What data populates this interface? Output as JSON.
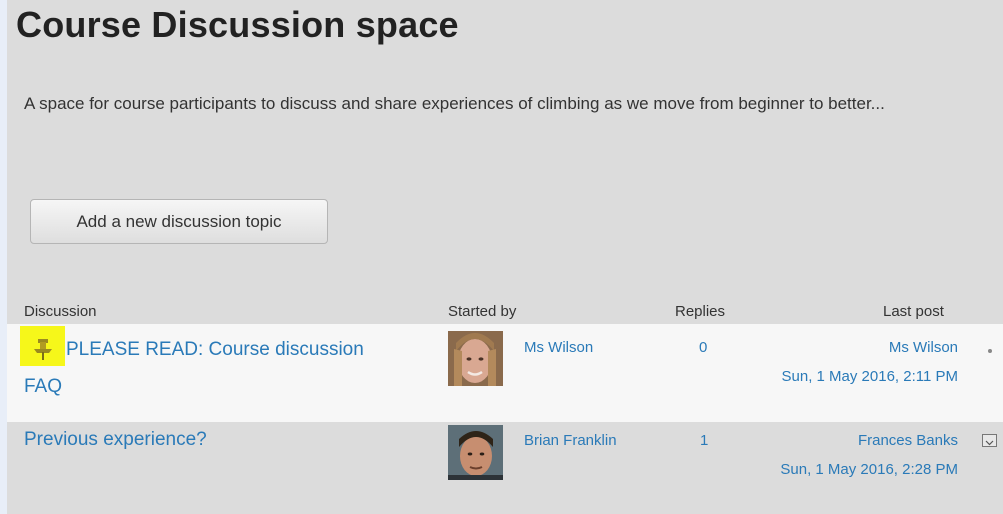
{
  "forum": {
    "title": "Course Discussion space",
    "intro": "A space for course participants to discuss and share experiences of climbing as we move from beginner to better...",
    "add_button_label": "Add a new discussion topic"
  },
  "table": {
    "headers": {
      "discussion": "Discussion",
      "started_by": "Started by",
      "replies": "Replies",
      "last_post": "Last post"
    },
    "rows": [
      {
        "topic_line1": "PLEASE READ: Course discussion",
        "topic_line2": "FAQ",
        "pinned": true,
        "author": "Ms Wilson",
        "replies": "0",
        "last_post_author": "Ms Wilson",
        "last_post_date": "Sun, 1 May 2016, 2:11 PM"
      },
      {
        "topic": "Previous experience?",
        "pinned": false,
        "author": "Brian Franklin",
        "replies": "1",
        "last_post_author": "Frances Banks",
        "last_post_date": "Sun, 1 May 2016, 2:28 PM"
      }
    ]
  },
  "colors": {
    "link": "#2a7ab8",
    "pin_highlight": "#f6f71a",
    "page_background": "#dcdcdc",
    "pinned_row_background": "#f7f7f7"
  },
  "icons": {
    "pin": "pin-icon",
    "row_menu": "menu-toggle-icon"
  }
}
